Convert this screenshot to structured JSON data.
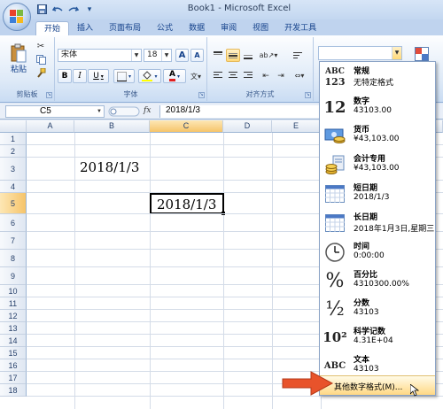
{
  "window": {
    "title": "Book1 - Microsoft Excel"
  },
  "qat": [
    "save-icon",
    "undo-icon",
    "redo-icon",
    "customize-icon"
  ],
  "tabs": [
    "开始",
    "插入",
    "页面布局",
    "公式",
    "数据",
    "审阅",
    "视图",
    "开发工具"
  ],
  "ribbon": {
    "clipboard": {
      "label": "剪贴板",
      "paste": "粘贴"
    },
    "font": {
      "label": "字体",
      "name": "宋体",
      "size": "18",
      "bold": "B",
      "italic": "I",
      "underline": "U",
      "grow": "A",
      "shrink": "A",
      "color_letter": "A"
    },
    "align": {
      "label": "对齐方式"
    }
  },
  "formula_bar": {
    "name_box": "C5",
    "fx": "fx",
    "value": "2018/1/3"
  },
  "sheet": {
    "columns": [
      "A",
      "B",
      "C",
      "D",
      "E"
    ],
    "rows": [
      "1",
      "2",
      "3",
      "4",
      "5",
      "6",
      "7",
      "8",
      "9",
      "10",
      "11",
      "12",
      "13",
      "14",
      "15",
      "16",
      "17",
      "18"
    ],
    "selected_column": "C",
    "selected_row": "5",
    "cells": {
      "B3": "2018/1/3",
      "C5": "2018/1/3"
    }
  },
  "format_menu": {
    "items": [
      {
        "title": "常规",
        "sub": "无特定格式",
        "icon": "general-format-icon",
        "glyph": "ABC\n123"
      },
      {
        "title": "数字",
        "sub": "43103.00",
        "icon": "number-format-icon",
        "glyph": "12"
      },
      {
        "title": "货币",
        "sub": "¥43,103.00",
        "icon": "currency-format-icon",
        "glyph": ""
      },
      {
        "title": "会计专用",
        "sub": " ¥43,103.00",
        "icon": "accounting-format-icon",
        "glyph": ""
      },
      {
        "title": "短日期",
        "sub": "2018/1/3",
        "icon": "short-date-icon",
        "glyph": ""
      },
      {
        "title": "长日期",
        "sub": "2018年1月3日,星期三",
        "icon": "long-date-icon",
        "glyph": ""
      },
      {
        "title": "时间",
        "sub": "0:00:00",
        "icon": "time-clock-icon",
        "glyph": ""
      },
      {
        "title": "百分比",
        "sub": "4310300.00%",
        "icon": "percent-icon",
        "glyph": "%"
      },
      {
        "title": "分数",
        "sub": "43103",
        "icon": "fraction-icon",
        "glyph": "½"
      },
      {
        "title": "科学记数",
        "sub": "4.31E+04",
        "icon": "scientific-icon",
        "glyph": "10²"
      },
      {
        "title": "文本",
        "sub": "43103",
        "icon": "text-format-icon",
        "glyph": "ABC"
      }
    ],
    "footer": "其他数字格式(M)..."
  }
}
